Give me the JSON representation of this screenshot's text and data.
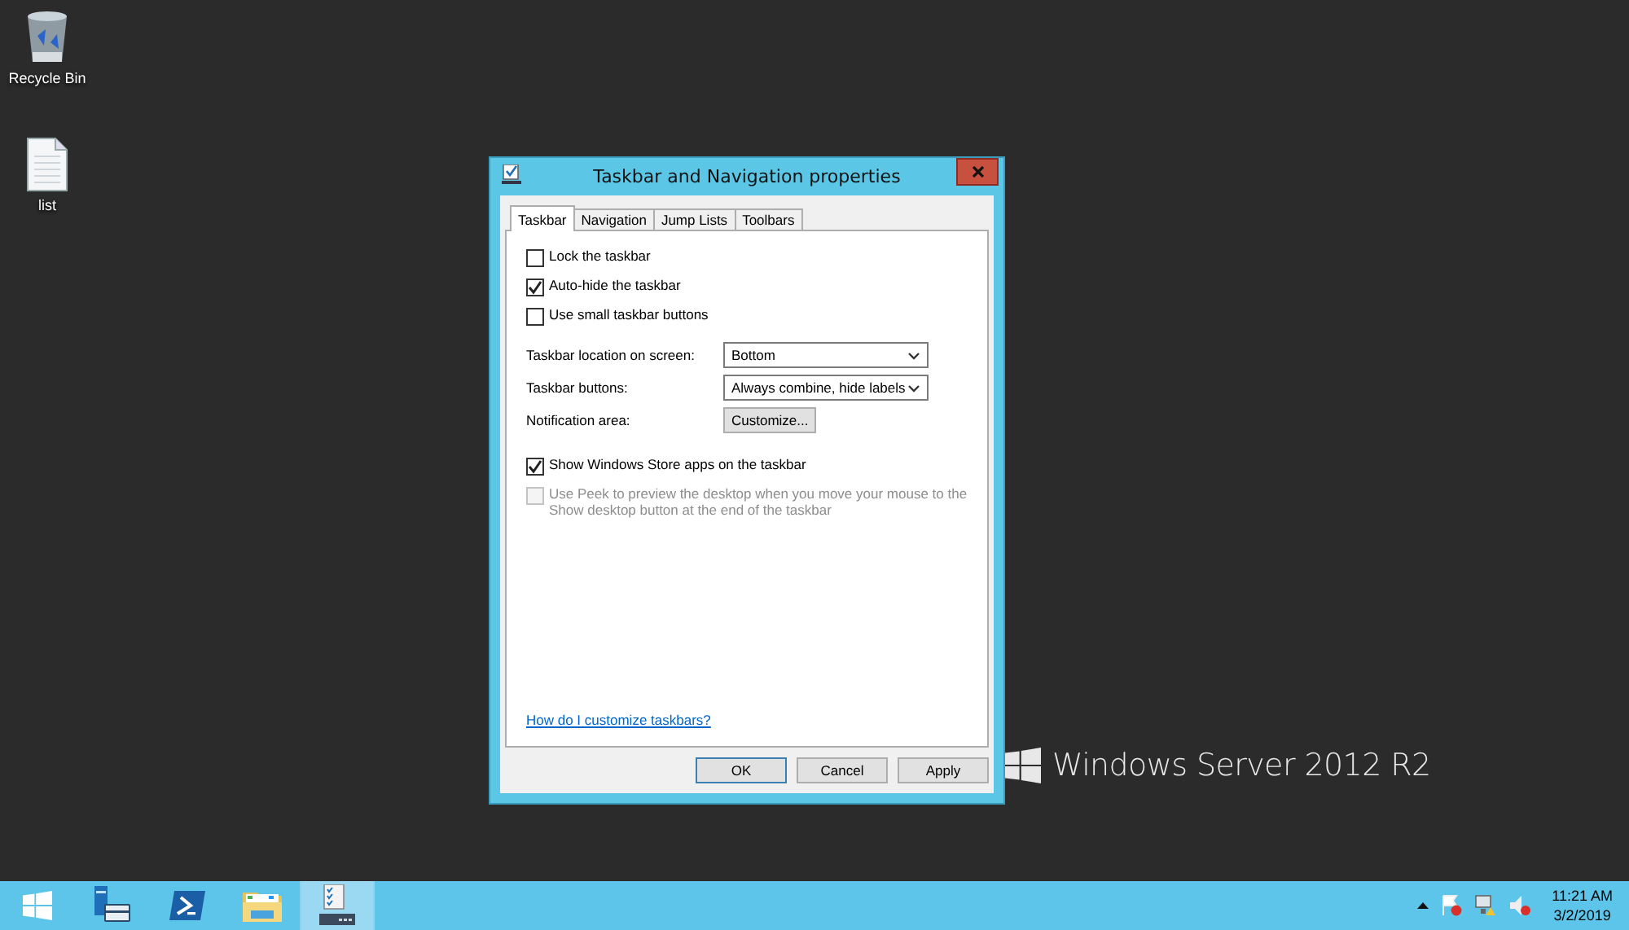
{
  "desktop_icons": [
    {
      "kind": "recycle",
      "label": "Recycle Bin"
    },
    {
      "kind": "file",
      "label": "list"
    }
  ],
  "wallpaper": {
    "brand": "Windows Server 2012 R2"
  },
  "dialog": {
    "title": "Taskbar and Navigation properties",
    "tabs": [
      {
        "label": "Taskbar",
        "selected": true
      },
      {
        "label": "Navigation",
        "selected": false
      },
      {
        "label": "Jump Lists",
        "selected": false
      },
      {
        "label": "Toolbars",
        "selected": false
      }
    ],
    "top_checkboxes": [
      {
        "label": "Lock the taskbar",
        "checked": false,
        "disabled": false
      },
      {
        "label": "Auto-hide the taskbar",
        "checked": true,
        "disabled": false
      },
      {
        "label": "Use small taskbar buttons",
        "checked": false,
        "disabled": false
      }
    ],
    "settings": [
      {
        "kind": "select",
        "label": "Taskbar location on screen:",
        "value": "Bottom"
      },
      {
        "kind": "select",
        "label": "Taskbar buttons:",
        "value": "Always combine, hide labels"
      },
      {
        "kind": "button",
        "label": "Notification area:",
        "value": "Customize..."
      }
    ],
    "bottom_checkboxes": [
      {
        "label": "Show Windows Store apps on the taskbar",
        "checked": true,
        "disabled": false
      },
      {
        "label": "Use Peek to preview the desktop when you move your mouse to the Show desktop button at the end of the taskbar",
        "checked": false,
        "disabled": true
      }
    ],
    "link": "How do I customize taskbars?",
    "buttons": [
      {
        "label": "OK",
        "default": true
      },
      {
        "label": "Cancel",
        "default": false
      },
      {
        "label": "Apply",
        "default": false
      }
    ]
  },
  "taskbar": {
    "apps": [
      {
        "kind": "server-manager",
        "selected": false
      },
      {
        "kind": "powershell",
        "selected": false
      },
      {
        "kind": "explorer",
        "selected": false
      },
      {
        "kind": "properties",
        "selected": true
      }
    ],
    "clock": {
      "time": "11:21 AM",
      "date": "3/2/2019"
    }
  }
}
